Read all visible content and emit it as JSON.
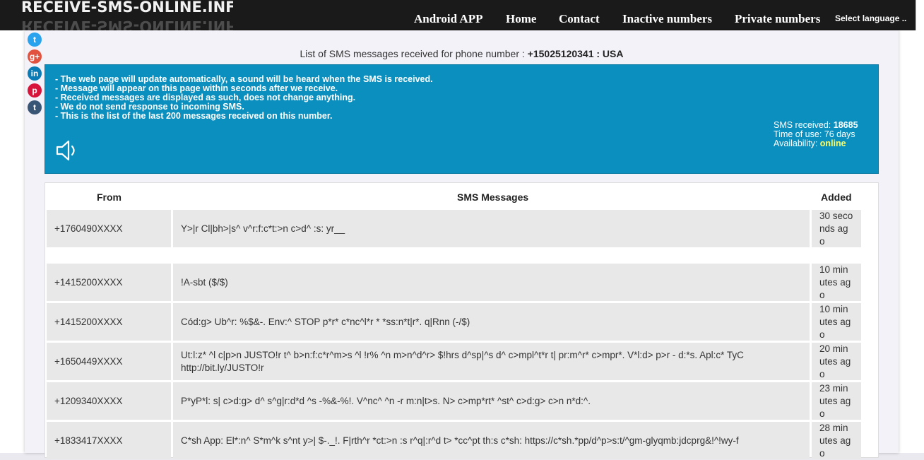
{
  "header": {
    "logo_text": "RECEIVE-SMS-ONLINE.INFO",
    "nav": [
      "Android APP",
      "Home",
      "Contact",
      "Inactive numbers",
      "Private numbers"
    ],
    "language_select": "Select language .."
  },
  "social": {
    "icons": [
      "twitter-icon",
      "google-plus-icon",
      "linkedin-icon",
      "pinterest-icon",
      "tumblr-icon"
    ],
    "colors": [
      "#2aa3ef",
      "#e2533f",
      "#0b7bb5",
      "#d7143a",
      "#3a5676"
    ],
    "glyphs": [
      "t",
      "g+",
      "in",
      "p",
      "t"
    ]
  },
  "page": {
    "heading_prefix": "List of SMS messages received for phone number :",
    "phone_number": "+15025120341 : USA"
  },
  "info": {
    "notes": [
      "- The web page will update automatically, a sound will be heard when the SMS is received.",
      "- Message will appear on this page within seconds after we receive.",
      "- Received messages are displayed as such, does not change anything.",
      "- We do not send response to incoming SMS.",
      "- This is the list of the last 200 messages received on this number."
    ],
    "sms_received_label": "SMS received:",
    "sms_received_value": "18685",
    "time_of_use": "Time of use: 76 days",
    "availability_label": "Availability:",
    "availability_value": "online"
  },
  "table": {
    "headers": [
      "From",
      "SMS Messages",
      "Added"
    ],
    "rows": [
      {
        "from": "+1760490XXXX",
        "message": "Y>|r Cl|bh>|s^ v^r:f:c*t:>n c>d^ :s: yr__",
        "added": "30 seconds ago"
      },
      {
        "from": "+1415200XXXX",
        "message": "!A-sbt ($/$)",
        "added": "10 minutes ago"
      },
      {
        "from": "+1415200XXXX",
        "message": "Cód:g> Ub^r: %$&-. Env:^ STOP p*r* c*nc^l*r * *ss:n*t|r*. q|Rnn (-/$)",
        "added": "10 minutes ago"
      },
      {
        "from": "+1650449XXXX",
        "message": "Ut:l:z* ^l c|p>n JUSTO!r t^ b>n:f:c*r^m>s ^l !r% ^n m>n^d^r> $!hrs d^sp|^s d^ c>mpl^t*r t| pr:m^r* c>mpr*. V*l:d> p>r - d:*s. Apl:c* TyC http://bit.ly/JUSTO!r",
        "added": "20 minutes ago"
      },
      {
        "from": "+1209340XXXX",
        "message": "P*yP*l: s| c>d:g> d^ s^g|r:d*d ^s -%&-%!. V^nc^ ^n -r m:n|t>s. N> c>mp*rt* ^st^ c>d:g> c>n n*d:^.",
        "added": "23 minutes ago"
      },
      {
        "from": "+1833417XXXX",
        "message": "C*sh App: El*:n^ S*m^k s^nt y>| $-._!. F|rth^r *ct:>n :s r^q|:r^d t> *cc^pt th:s c*sh: https://c*sh.*pp/d^p>s:t/^gm-glyqmb:jdcprg&!^!wy-f",
        "added": "28 minutes ago"
      }
    ]
  }
}
